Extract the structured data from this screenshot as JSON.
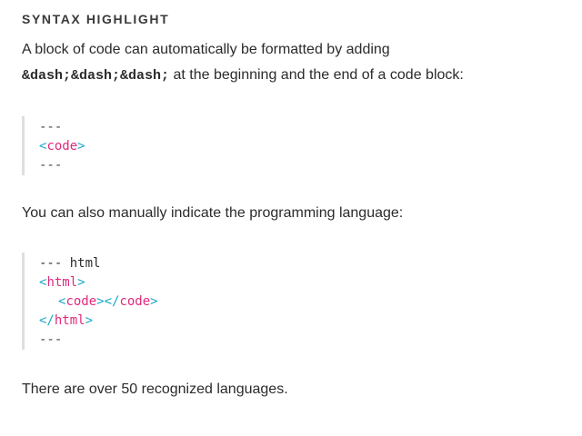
{
  "section": {
    "title": "SYNTAX HIGHLIGHT",
    "intro_text": "A block of code can automatically be formatted by adding",
    "intro_code": "&dash;&dash;&dash;",
    "intro_suffix": " at the beginning and the end of a code block:",
    "manual_text": "You can also manually indicate the programming language:",
    "footer_text": "There are over 50 recognized languages."
  },
  "code_block_1": {
    "open_fence": "---",
    "tag_open_bracket": "<",
    "tag_name": "code",
    "tag_close_bracket": ">",
    "close_fence": "---"
  },
  "code_block_2": {
    "open_fence": "--- html",
    "line1": {
      "lt": "<",
      "name": "html",
      "gt": ">"
    },
    "line2": {
      "lt1": "<",
      "name1": "code",
      "gt1": "></",
      "name2": "code",
      "gt2": ">"
    },
    "line3": {
      "lt": "</",
      "name": "html",
      "gt": ">"
    },
    "close_fence": "---"
  },
  "colors": {
    "bracket": "#1aa8c9",
    "tag_name": "#e0297a",
    "block_border": "#dedede"
  }
}
